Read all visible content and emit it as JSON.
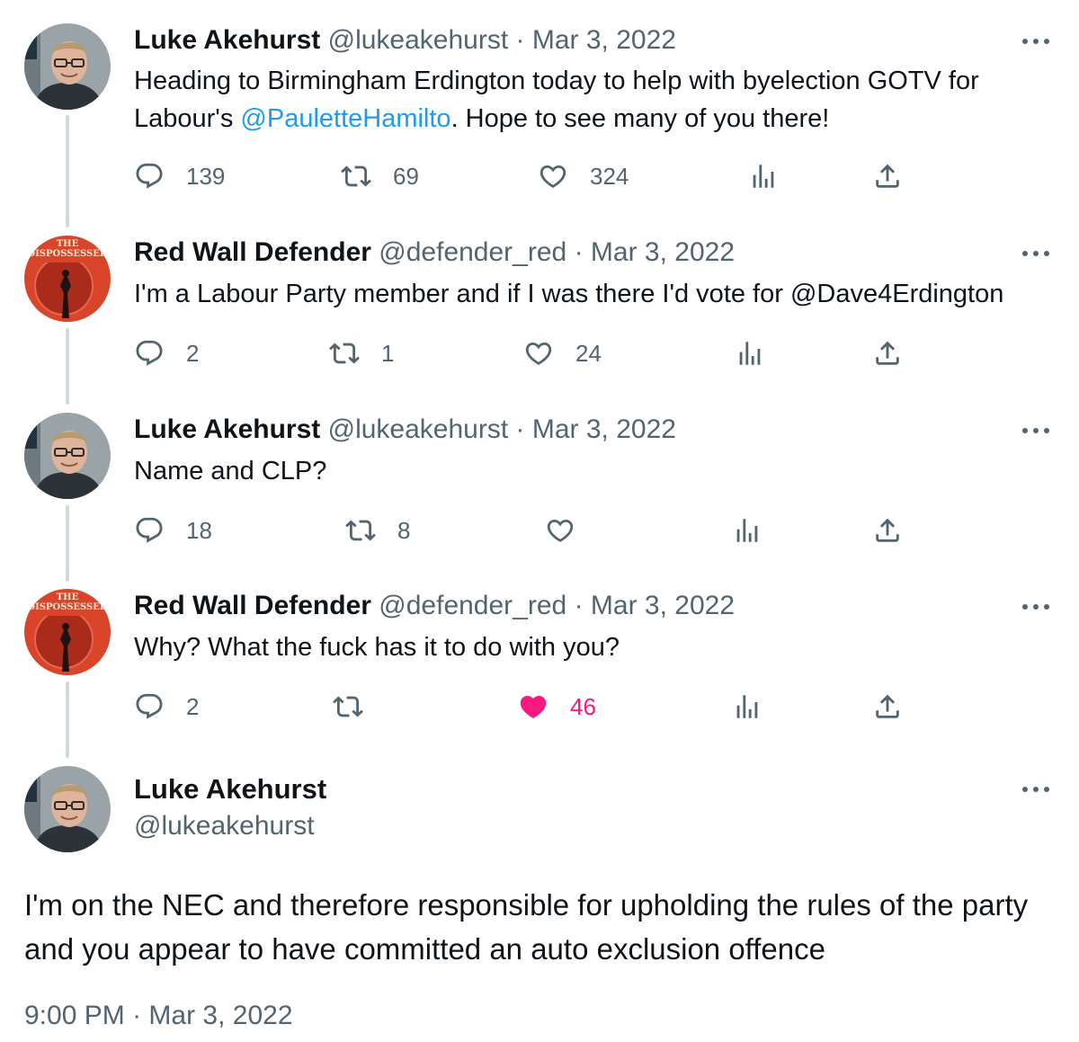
{
  "users": {
    "luke": {
      "name": "Luke Akehurst",
      "handle": "@lukeakehurst"
    },
    "red": {
      "name": "Red Wall Defender",
      "handle": "@defender_red",
      "avatar_caption_1": "THE",
      "avatar_caption_2": "DISPOSSESSED"
    }
  },
  "tweets": [
    {
      "name": "Luke Akehurst",
      "handle": "@lukeakehurst",
      "sep": "·",
      "date": "Mar 3, 2022",
      "text_before": "Heading to Birmingham Erdington today to help with byelection GOTV for",
      "text_line2_before": "Labour's ",
      "mention": "@PauletteHamilto",
      "text_after": ". Hope to see many of you there!",
      "replies": "139",
      "retweets": "69",
      "likes": "324"
    },
    {
      "name": "Red Wall Defender",
      "handle": "@defender_red",
      "sep": "·",
      "date": "Mar 3, 2022",
      "text": "I'm a Labour Party member and if I was there I'd vote for @Dave4Erdington",
      "replies": "2",
      "retweets": "1",
      "likes": "24"
    },
    {
      "name": "Luke Akehurst",
      "handle": "@lukeakehurst",
      "sep": "·",
      "date": "Mar 3, 2022",
      "text": "Name and CLP?",
      "replies": "18",
      "retweets": "8",
      "likes": ""
    },
    {
      "name": "Red Wall Defender",
      "handle": "@defender_red",
      "sep": "·",
      "date": "Mar 3, 2022",
      "text": "Why? What the fuck has it to do with you?",
      "replies": "2",
      "retweets": "",
      "likes": "46",
      "liked": true
    }
  ],
  "main_tweet": {
    "name": "Luke Akehurst",
    "handle": "@lukeakehurst",
    "text": "I'm on the NEC and therefore responsible for upholding the rules of the party and you appear to have committed an auto exclusion offence",
    "time": "9:00 PM",
    "sep": "·",
    "date": "Mar 3, 2022"
  },
  "icons": {
    "reply": "reply-icon",
    "retweet": "retweet-icon",
    "like": "heart-icon",
    "views": "analytics-icon",
    "share": "share-icon",
    "more": "more-icon"
  },
  "colors": {
    "text": "#0f1419",
    "muted": "#536471",
    "mention": "#1d9bf0",
    "like_active": "#f91880",
    "thread_line": "#cfd9de"
  }
}
